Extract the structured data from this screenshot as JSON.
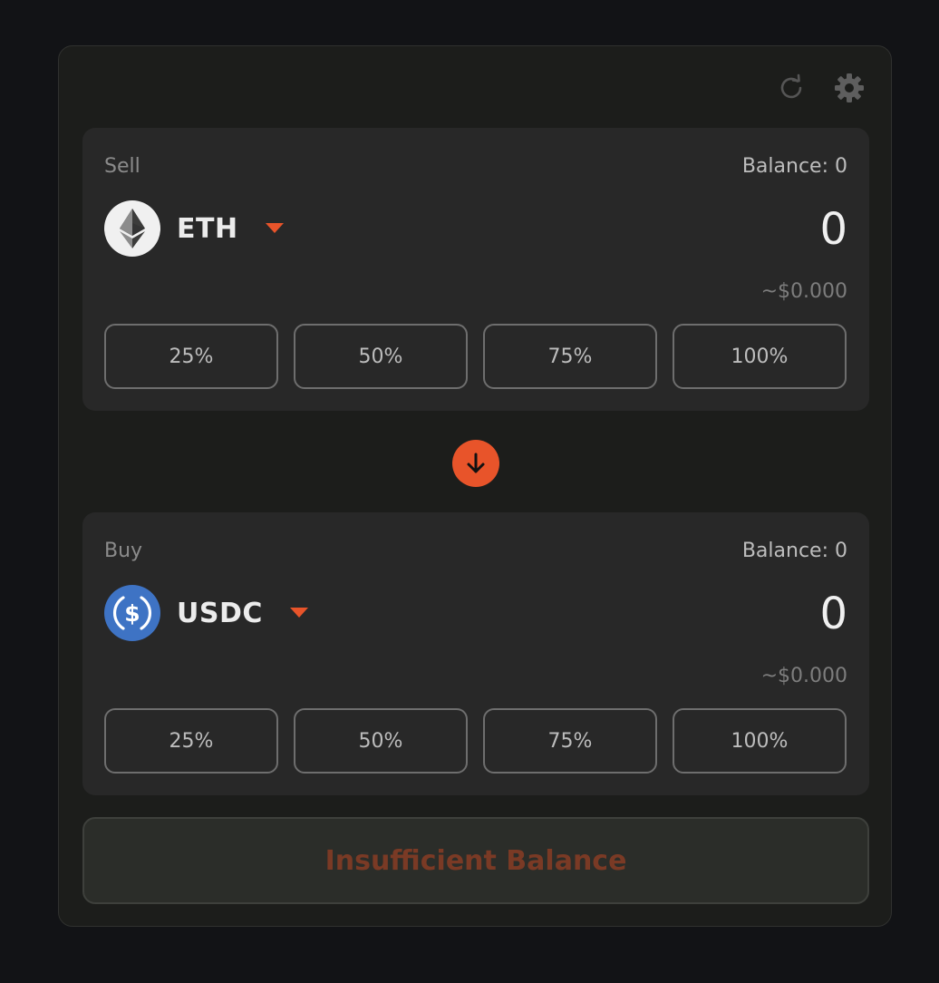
{
  "header": {
    "icons": [
      "refresh-icon",
      "gear-icon"
    ]
  },
  "sell": {
    "label": "Sell",
    "balance": "Balance: 0",
    "token_symbol": "ETH",
    "token_icon": "ethereum-logo-icon",
    "amount": "0",
    "usd_value": "~$0.000",
    "percent_buttons": [
      "25%",
      "50%",
      "75%",
      "100%"
    ]
  },
  "swap_direction_icon": "arrow-down-icon",
  "buy": {
    "label": "Buy",
    "balance": "Balance: 0",
    "token_symbol": "USDC",
    "token_icon": "usdc-logo-icon",
    "amount": "0",
    "usd_value": "~$0.000",
    "percent_buttons": [
      "25%",
      "50%",
      "75%",
      "100%"
    ]
  },
  "action_button": {
    "label": "Insufficient Balance"
  },
  "colors": {
    "accent": "#e8542a",
    "usdc_blue": "#3e73c4",
    "panel_bg": "#282828",
    "widget_bg": "#1c1d1b"
  }
}
